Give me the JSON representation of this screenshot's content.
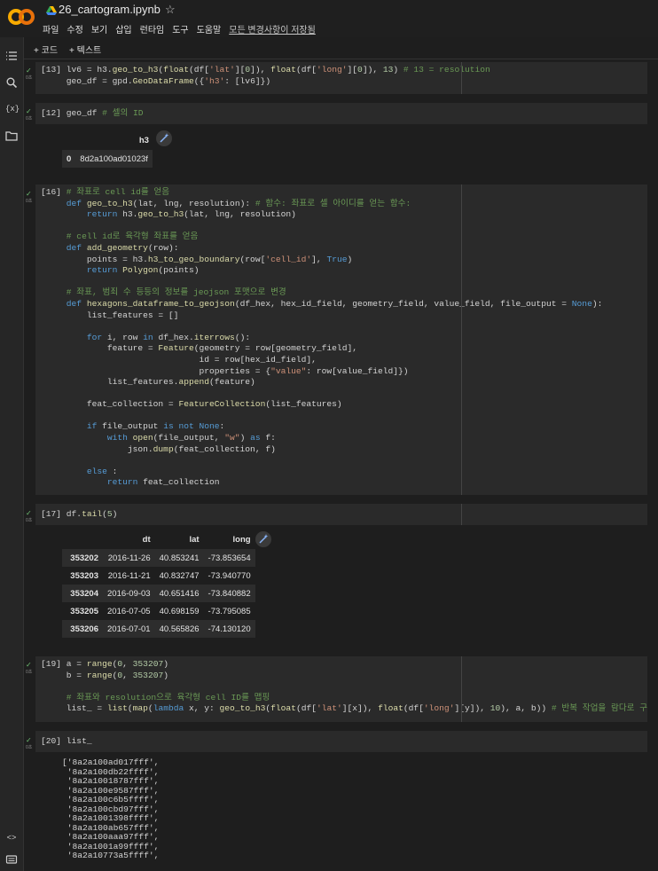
{
  "header": {
    "title": "26_cartogram.ipynb",
    "menu": [
      "파일",
      "수정",
      "보기",
      "삽입",
      "런타임",
      "도구",
      "도움말"
    ],
    "saved_status": "모든 변경사항이 저장됨"
  },
  "toolbar": {
    "add_code": "+ 코드",
    "add_text": "+ 텍스트"
  },
  "cells": [
    {
      "id": "[13]",
      "lines": [
        "lv6 = h3.geo_to_h3(float(df['lat'][0]), float(df['long'][0]), 13) # 13 = resolution",
        "geo_df = gpd.GeoDataFrame({'h3': [lv6]})"
      ]
    },
    {
      "id": "[12]",
      "lines": [
        "geo_df # 셀의 ID"
      ]
    },
    {
      "id": "[16]",
      "lines": [
        "# 좌표로 cell id를 얻음",
        "def geo_to_h3(lat, lng, resolution): # 함수: 좌표로 셀 아이디를 얻는 함수:",
        "    return h3.geo_to_h3(lat, lng, resolution)",
        "",
        "# cell id로 육각형 좌표를 얻음",
        "def add_geometry(row):",
        "    points = h3.h3_to_geo_boundary(row['cell_id'], True)",
        "    return Polygon(points)",
        "",
        "# 좌표, 범죄 수 등등의 정보를 jeojson 포맷으로 변경",
        "def hexagons_dataframe_to_geojson(df_hex, hex_id_field, geometry_field, value_field, file_output = None):",
        "    list_features = []",
        "",
        "    for i, row in df_hex.iterrows():",
        "        feature = Feature(geometry = row[geometry_field],",
        "                          id = row[hex_id_field],",
        "                          properties = {\"value\": row[value_field]})",
        "        list_features.append(feature)",
        "",
        "    feat_collection = FeatureCollection(list_features)",
        "",
        "    if file_output is not None:",
        "        with open(file_output, \"w\") as f:",
        "            json.dump(feat_collection, f)",
        "",
        "    else :",
        "        return feat_collection"
      ]
    },
    {
      "id": "[17]",
      "lines": [
        "df.tail(5)"
      ]
    },
    {
      "id": "[19]",
      "lines": [
        "a = range(0, 353207)",
        "b = range(0, 353207)",
        "",
        "# 좌표와 resolution으로 육각형 cell ID를 맵핑",
        "list_ = list(map(lambda x, y: geo_to_h3(float(df['lat'][x]), float(df['long'][y]), 10), a, b)) # 반복 작업을 람다로 구현"
      ]
    },
    {
      "id": "[20]",
      "lines": [
        "list_"
      ]
    }
  ],
  "geo_df_output": {
    "columns": [
      "h3"
    ],
    "rows": [
      [
        "0",
        "8d2a100ad01023f"
      ]
    ]
  },
  "df_tail_output": {
    "columns": [
      "dt",
      "lat",
      "long"
    ],
    "rows": [
      [
        "353202",
        "2016-11-26",
        "40.853241",
        "-73.853654"
      ],
      [
        "353203",
        "2016-11-21",
        "40.832747",
        "-73.940770"
      ],
      [
        "353204",
        "2016-09-03",
        "40.651416",
        "-73.840882"
      ],
      [
        "353205",
        "2016-07-05",
        "40.698159",
        "-73.795085"
      ],
      [
        "353206",
        "2016-07-01",
        "40.565826",
        "-74.130120"
      ]
    ]
  },
  "list_output": [
    "['8a2a100ad017fff',",
    " '8a2a100db22ffff',",
    " '8a2a10018787fff',",
    " '8a2a100e9587fff',",
    " '8a2a100c6b5ffff',",
    " '8a2a100cbd97fff',",
    " '8a2a1001398ffff',",
    " '8a2a100ab657fff',",
    " '8a2a100aaa97fff',",
    " '8a2a1001a99ffff',",
    " '8a2a10773a5ffff',"
  ],
  "exec_marker": "0초",
  "colors": {
    "background": "#1e1e1e",
    "cell": "#2a2a2a",
    "keyword": "#569cd6",
    "comment": "#6a9955",
    "string": "#ce9178"
  }
}
